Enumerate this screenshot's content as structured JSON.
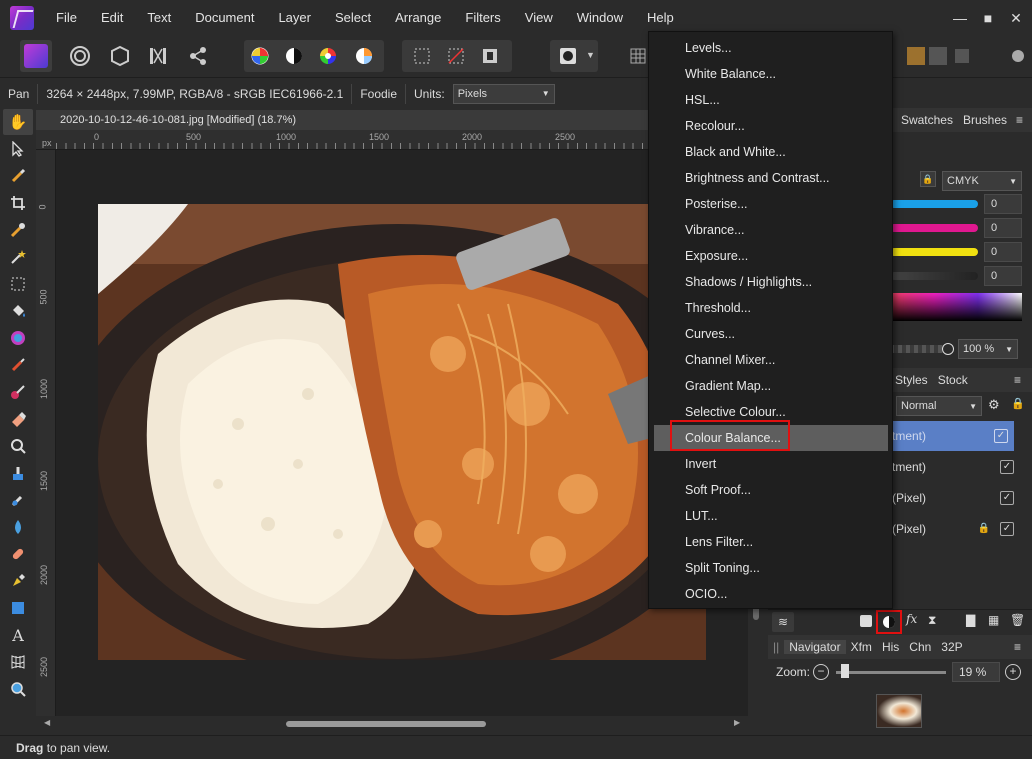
{
  "menubar": {
    "items": [
      "File",
      "Edit",
      "Text",
      "Document",
      "Layer",
      "Select",
      "Arrange",
      "Filters",
      "View",
      "Window",
      "Help"
    ]
  },
  "context": {
    "tool_name": "Pan",
    "doc_info": "3264 × 2448px, 7.99MP, RGBA/8 - sRGB IEC61966-2.1",
    "camera": "Foodie",
    "units_label": "Units:",
    "units_value": "Pixels"
  },
  "document": {
    "tab_title": "2020-10-10-12-46-10-081.jpg [Modified] (18.7%)",
    "ruler_h_unit": "px",
    "ruler_h_ticks": [
      "0",
      "500",
      "1000",
      "1500",
      "2000",
      "2500"
    ],
    "ruler_v_ticks": [
      "0",
      "500",
      "1000",
      "1500",
      "2000",
      "2500"
    ]
  },
  "status": {
    "bold": "Drag",
    "text": "to pan view."
  },
  "colour_panel": {
    "tabs": [
      "Swatches",
      "Brushes"
    ],
    "model": "CMYK",
    "channels": [
      {
        "value": "0",
        "color": "#1aa0e8"
      },
      {
        "value": "0",
        "color": "#e01890"
      },
      {
        "value": "0",
        "color": "#f0e010"
      },
      {
        "value": "0",
        "color": "#222222"
      }
    ],
    "opacity": "100 %"
  },
  "layers_panel": {
    "tabs": [
      "Styles",
      "Stock"
    ],
    "blend_mode": "Normal",
    "rows": [
      {
        "label": "tment)",
        "checked": "✓",
        "selected": true
      },
      {
        "label": "tment)",
        "checked": "✓",
        "selected": false
      },
      {
        "label": "(Pixel)",
        "checked": "✓",
        "selected": false
      },
      {
        "label": "(Pixel)",
        "checked": "✓",
        "selected": false
      }
    ]
  },
  "navigator": {
    "tabs": [
      "Navigator",
      "Xfm",
      "His",
      "Chn",
      "32P"
    ],
    "zoom_label": "Zoom:",
    "zoom_value": "19 %"
  },
  "adjust_menu": {
    "items": [
      "Levels...",
      "White Balance...",
      "HSL...",
      "Recolour...",
      "Black and White...",
      "Brightness and Contrast...",
      "Posterise...",
      "Vibrance...",
      "Exposure...",
      "Shadows / Highlights...",
      "Threshold...",
      "Curves...",
      "Channel Mixer...",
      "Gradient Map...",
      "Selective Colour...",
      "Colour Balance...",
      "Invert",
      "Soft Proof...",
      "LUT...",
      "Lens Filter...",
      "Split Toning...",
      "OCIO..."
    ],
    "highlighted_index": 15
  },
  "colors": {
    "highlight_box": "#e01010",
    "layer_selected": "#5a7fc6"
  }
}
